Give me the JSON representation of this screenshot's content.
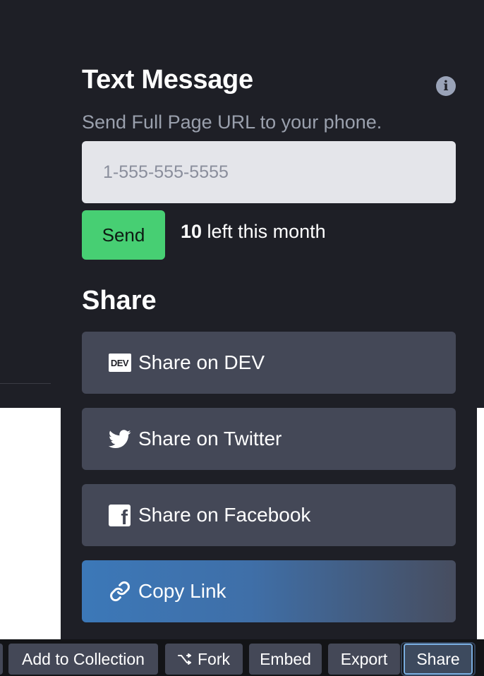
{
  "text_message": {
    "title": "Text Message",
    "description": "Send Full Page URL to your phone.",
    "phone_placeholder": "1-555-555-5555",
    "phone_value": "",
    "send_label": "Send",
    "count": "10",
    "count_suffix": " left this month",
    "info_icon": "info-icon"
  },
  "share": {
    "heading": "Share",
    "buttons": [
      {
        "label": "Share on DEV",
        "icon": "dev-icon"
      },
      {
        "label": "Share on Twitter",
        "icon": "twitter-icon"
      },
      {
        "label": "Share on Facebook",
        "icon": "facebook-icon"
      },
      {
        "label": "Copy Link",
        "icon": "link-icon"
      }
    ],
    "dev_badge_text": "DEV"
  },
  "toolbar": {
    "add_to_collection": "Add to Collection",
    "fork": "Fork",
    "embed": "Embed",
    "export": "Export",
    "share": "Share"
  },
  "colors": {
    "background": "#1e1f26",
    "button": "#444857",
    "send_green": "#47cf73",
    "copy_link_blue": "#3c78b8"
  }
}
